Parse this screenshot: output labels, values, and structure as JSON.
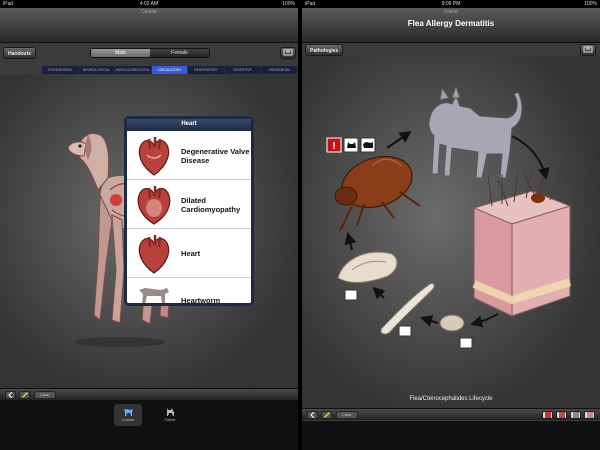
{
  "left": {
    "status": {
      "carrier": "iPad",
      "time": "4:02 AM",
      "battery": "100%"
    },
    "app_title": "Canine",
    "handouts_label": "Handouts",
    "gender": {
      "options": [
        "Male",
        "Female"
      ],
      "selected": "Male"
    },
    "system_tabs": [
      "EYE/EAR/SKIN",
      "NEUROLOGICAL",
      "MUSCULOSKELETAL",
      "CIRCULATORY",
      "RESPIRATORY",
      "DIGESTIVE",
      "UROGENITAL"
    ],
    "selected_tab": "CIRCULATORY",
    "popover": {
      "title": "Heart",
      "items": [
        "Degenerative Valve Disease",
        "Dilated Cardiomyopathy",
        "Heart",
        "Heartworm"
      ]
    },
    "toolbar": {
      "clear_label": "Clear"
    },
    "bottom_tabs": [
      {
        "label": "Canine",
        "icon": "dog-icon"
      },
      {
        "label": "Feline",
        "icon": "cat-icon"
      }
    ]
  },
  "right": {
    "status": {
      "carrier": "iPad",
      "time": "9:09 PM",
      "battery": "100%"
    },
    "app_title": "Feline",
    "pathologies_label": "Pathologies",
    "title": "Flea Allergy Dermatitis",
    "caption": "Flea/Ctenocephalides Lifecycle",
    "toolbar": {
      "clear_label": "Clear"
    }
  },
  "colors": {
    "selected_tab": "#3a5bd6",
    "alert_red": "#c0161a",
    "popover_header": "#1e2a44"
  }
}
